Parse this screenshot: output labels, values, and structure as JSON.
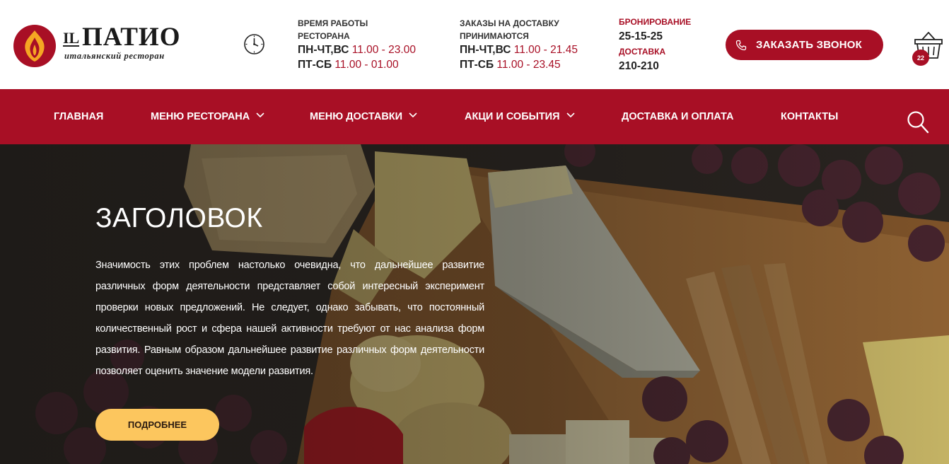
{
  "logo": {
    "prefix": "IL",
    "name": "ПАТИО",
    "subtitle": "итальянский ресторан"
  },
  "hours": {
    "caption_line1": "ВРЕМЯ РАБОТЫ",
    "caption_line2": "РЕСТОРАНА",
    "rows": [
      {
        "days": "ПН-ЧТ,ВС",
        "time": "11.00 - 23.00"
      },
      {
        "days": "ПТ-СБ",
        "time": "11.00 - 01.00"
      }
    ]
  },
  "delivery_hours": {
    "caption_line1": "ЗАКАЗЫ НА ДОСТАВКУ",
    "caption_line2": "ПРИНИМАЮТСЯ",
    "rows": [
      {
        "days": "ПН-ЧТ,ВС",
        "time": "11.00 - 21.45"
      },
      {
        "days": "ПТ-СБ",
        "time": "11.00 - 23.45"
      }
    ]
  },
  "contacts": {
    "booking_label": "БРОНИРОВАНИЕ",
    "booking_phone": "25-15-25",
    "delivery_label": "ДОСТАВКА",
    "delivery_phone": "210-210"
  },
  "call_button": {
    "label": "ЗАКАЗАТЬ ЗВОНОК",
    "icon": "phone-icon"
  },
  "cart": {
    "icon": "basket-icon",
    "count": "22"
  },
  "nav": {
    "items": [
      {
        "label": "ГЛАВНАЯ",
        "dropdown": false
      },
      {
        "label": "МЕНЮ РЕСТОРАНА",
        "dropdown": true
      },
      {
        "label": "МЕНЮ ДОСТАВКИ",
        "dropdown": true
      },
      {
        "label": "АКЦИ И СОБЫТИЯ",
        "dropdown": true
      },
      {
        "label": "ДОСТАВКА И ОПЛАТА",
        "dropdown": false
      },
      {
        "label": "КОНТАКТЫ",
        "dropdown": false
      }
    ],
    "search_icon": "search-icon"
  },
  "hero": {
    "title": "ЗАГОЛОВОК",
    "text": "Значимость этих проблем настолько очевидна, что дальнейшее развитие различных форм деятельности представляет собой интересный эксперимент проверки новых предложений. Не следует, однако забывать, что постоянный количественный рост и сфера нашей активности требуют от нас анализа форм развития. Равным образом дальнейшее развитие различных форм деятельности позволяет оценить значение модели развития.",
    "button": "ПОДРОБНЕЕ"
  },
  "colors": {
    "brand": "#a80f25",
    "accent": "#fcc65e"
  }
}
